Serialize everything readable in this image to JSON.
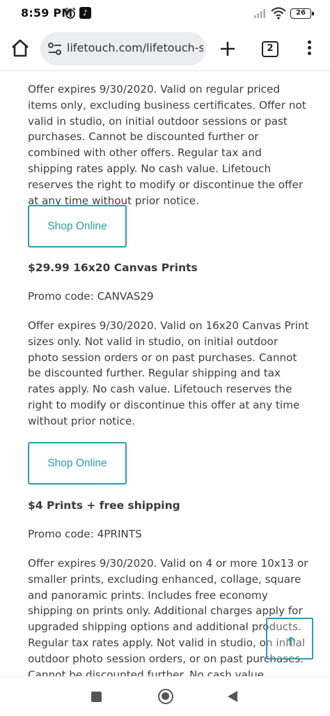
{
  "status_bar": {
    "time": "8:59 PM",
    "battery": "26",
    "icons": [
      "alarm-icon",
      "tiktok-icon",
      "signal-icon",
      "wifi-icon",
      "battery-icon"
    ]
  },
  "browser": {
    "url": "lifetouch.com/lifetouch-sh",
    "tab_count": "2",
    "icons": [
      "home-icon",
      "site-settings-icon",
      "plus-icon",
      "tabs-icon",
      "more-vert-icon"
    ]
  },
  "offers": {
    "intro_terms": "Offer expires 9/30/2020. Valid on regular priced items only, excluding business certificates. Offer not valid in studio, on initial outdoor sessions or past purchases. Cannot be discounted further or combined with other offers. Regular tax and shipping rates apply. No cash value. Lifetouch reserves the right to modify or discontinue the offer at any time without prior notice.",
    "shop_label": "Shop Online",
    "items": [
      {
        "title": "$29.99 16x20 Canvas Prints",
        "promo": "Promo code: CANVAS29",
        "terms": "Offer expires 9/30/2020. Valid on 16x20 Canvas Print sizes only. Not valid in studio, on initial outdoor photo session orders or on past purchases. Cannot be discounted further. Regular shipping and tax rates apply. No cash value. Lifetouch reserves the right to modify or discontinue this offer at any time without prior notice."
      },
      {
        "title": "$4 Prints + free shipping",
        "promo": "Promo code: 4PRINTS",
        "terms": "Offer expires 9/30/2020. Valid on 4 or more 10x13 or smaller prints, excluding enhanced, collage, square and panoramic prints. Includes free economy shipping on prints only. Additional charges apply for upgraded shipping options and additional products. Regular tax rates apply. Not valid in studio, on initial outdoor photo session orders, or on past purchases. Cannot be discounted further. No cash value."
      }
    ]
  },
  "colors": {
    "accent": "#2b9cb1",
    "body_text": "#3d3d3d",
    "url_bar_bg": "#ecedf1"
  }
}
